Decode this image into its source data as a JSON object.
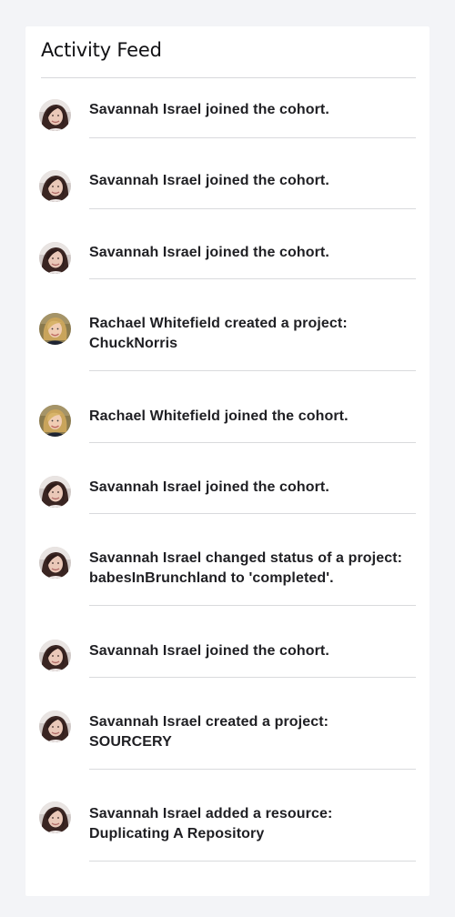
{
  "feed": {
    "title": "Activity Feed",
    "items": [
      {
        "avatar": "savannah-avatar",
        "line1": "Savannah Israel joined the cohort.",
        "line2": ""
      },
      {
        "avatar": "savannah-avatar",
        "line1": "Savannah Israel joined the cohort.",
        "line2": ""
      },
      {
        "avatar": "savannah-avatar",
        "line1": "Savannah Israel joined the cohort.",
        "line2": ""
      },
      {
        "avatar": "rachael-avatar",
        "line1": "Rachael Whitefield created a project:",
        "line2": "ChuckNorris"
      },
      {
        "avatar": "rachael-avatar",
        "line1": "Rachael Whitefield joined the cohort.",
        "line2": ""
      },
      {
        "avatar": "savannah-avatar",
        "line1": "Savannah Israel joined the cohort.",
        "line2": ""
      },
      {
        "avatar": "savannah-avatar",
        "line1": "Savannah Israel changed status of a project:",
        "line2": "babesInBrunchland to 'completed'."
      },
      {
        "avatar": "savannah-avatar",
        "line1": "Savannah Israel joined the cohort.",
        "line2": ""
      },
      {
        "avatar": "savannah-avatar",
        "line1": "Savannah Israel created a project:",
        "line2": "SOURCERY"
      },
      {
        "avatar": "savannah-avatar",
        "line1": "Savannah Israel added a resource:",
        "line2": "Duplicating A Repository"
      }
    ]
  },
  "colors": {
    "page_background": "#f3f4f7",
    "card_background": "#ffffff",
    "text": "#1f1f23",
    "divider": "#d9dadd"
  }
}
